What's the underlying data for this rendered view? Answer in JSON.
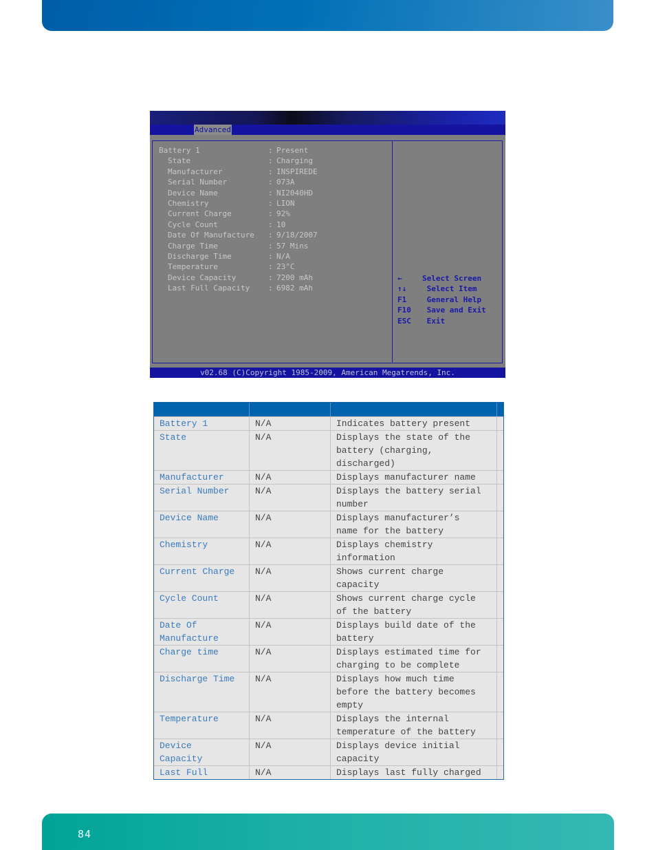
{
  "page": {
    "number": "84"
  },
  "bios": {
    "active_tab": "Advanced",
    "rows": [
      {
        "label": "Battery 1",
        "indent": false,
        "value": "Present"
      },
      {
        "label": "State",
        "indent": true,
        "value": "Charging"
      },
      {
        "label": "Manufacturer",
        "indent": true,
        "value": "INSPIREDE"
      },
      {
        "label": "Serial Number",
        "indent": true,
        "value": "073A"
      },
      {
        "label": "Device Name",
        "indent": true,
        "value": "NI2040HD"
      },
      {
        "label": "Chemistry",
        "indent": true,
        "value": "LION"
      },
      {
        "label": "Current Charge",
        "indent": true,
        "value": "92%"
      },
      {
        "label": "Cycle Count",
        "indent": true,
        "value": "10"
      },
      {
        "label": "Date Of Manufacture",
        "indent": true,
        "value": "9/18/2007"
      },
      {
        "label": "Charge Time",
        "indent": true,
        "value": "57 Mins"
      },
      {
        "label": "Discharge Time",
        "indent": true,
        "value": "N/A"
      },
      {
        "label": "Temperature",
        "indent": true,
        "value": "23°C"
      },
      {
        "label": "Device Capacity",
        "indent": true,
        "value": "7200 mAh"
      },
      {
        "label": "Last Full Capacity",
        "indent": true,
        "value": "6982 mAh"
      }
    ],
    "separator": ":",
    "help": [
      {
        "key": "←",
        "desc": "Select Screen",
        "icon": "arrow-left-icon"
      },
      {
        "key": "↑↓",
        "desc": " Select Item",
        "icon": "arrow-up-down-icon"
      },
      {
        "key": "F1",
        "desc": " General Help"
      },
      {
        "key": "F10",
        "desc": " Save and Exit"
      },
      {
        "key": "ESC",
        "desc": " Exit"
      }
    ],
    "footer": "v02.68 (C)Copyright 1985-2009, American Megatrends, Inc."
  },
  "table": {
    "headers": [
      "",
      "",
      ""
    ],
    "rows": [
      {
        "name": [
          "Battery 1"
        ],
        "default": "N/A",
        "desc": [
          "Indicates  battery present"
        ]
      },
      {
        "name": [
          "State"
        ],
        "default": "N/A",
        "desc": [
          "Displays the state of the",
          "battery (charging,",
          "discharged)"
        ]
      },
      {
        "name": [
          "Manufacturer"
        ],
        "default": "N/A",
        "desc": [
          "Displays manufacturer name"
        ]
      },
      {
        "name": [
          "Serial Number"
        ],
        "default": "N/A",
        "desc": [
          "Displays the battery serial",
          "number"
        ]
      },
      {
        "name": [
          "Device Name"
        ],
        "default": "N/A",
        "desc": [
          "Displays manufacturer’s",
          "name for the battery"
        ]
      },
      {
        "name": [
          "Chemistry"
        ],
        "default": "N/A",
        "desc": [
          "Displays chemistry",
          "information"
        ]
      },
      {
        "name": [
          "Current Charge"
        ],
        "default": "N/A",
        "desc": [
          "Shows current charge",
          "capacity"
        ]
      },
      {
        "name": [
          "Cycle Count"
        ],
        "default": "N/A",
        "desc": [
          "Shows current charge cycle",
          "of the battery"
        ]
      },
      {
        "name": [
          "Date Of",
          "Manufacture"
        ],
        "default": "N/A",
        "desc": [
          "Displays build date of the",
          "battery"
        ]
      },
      {
        "name": [
          "Charge time"
        ],
        "default": "N/A",
        "desc": [
          "Displays estimated time for",
          "charging to be complete"
        ]
      },
      {
        "name": [
          "Discharge Time"
        ],
        "default": "N/A",
        "desc": [
          "Displays how much time",
          "before the battery becomes",
          "empty"
        ]
      },
      {
        "name": [
          "Temperature"
        ],
        "default": "N/A",
        "desc": [
          "Displays the internal",
          "temperature of the battery"
        ]
      },
      {
        "name": [
          "Device",
          "Capacity"
        ],
        "default": "N/A",
        "desc": [
          "Displays device initial",
          "capacity"
        ]
      },
      {
        "name": [
          "Last Full"
        ],
        "default": "N/A",
        "desc": [
          "Displays last fully charged"
        ]
      }
    ]
  },
  "colors": {
    "header_band": "#0063ad",
    "footer_band": "#00a497",
    "bios_blue": "#1414a0",
    "bios_gray": "#7f7f7f",
    "link_blue": "#3b7bbf"
  }
}
